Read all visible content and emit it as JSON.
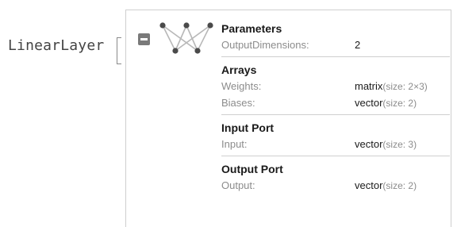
{
  "header": {
    "head": "LinearLayer"
  },
  "panel": {
    "sections": [
      {
        "title": "Parameters",
        "rows": [
          {
            "key": "OutputDimensions:",
            "value": "2",
            "note": ""
          }
        ]
      },
      {
        "title": "Arrays",
        "rows": [
          {
            "key": "Weights:",
            "value": "matrix",
            "note": "(size: 2×3)"
          },
          {
            "key": "Biases:",
            "value": "vector",
            "note": "(size: 2)"
          }
        ]
      },
      {
        "title": "Input Port",
        "rows": [
          {
            "key": "Input:",
            "value": "vector",
            "note": "(size: 3)"
          }
        ]
      },
      {
        "title": "Output Port",
        "rows": [
          {
            "key": "Output:",
            "value": "vector",
            "note": "(size: 2)"
          }
        ]
      }
    ]
  },
  "icons": {
    "toggle": "collapse-toggle-icon",
    "network": "neural-network-icon"
  },
  "colors": {
    "node": "#4a4a4a",
    "edge": "#b8b8b8",
    "toggle": "#7a7a7a",
    "divider": "#cfcfcf",
    "key_text": "#8c8c8c"
  }
}
